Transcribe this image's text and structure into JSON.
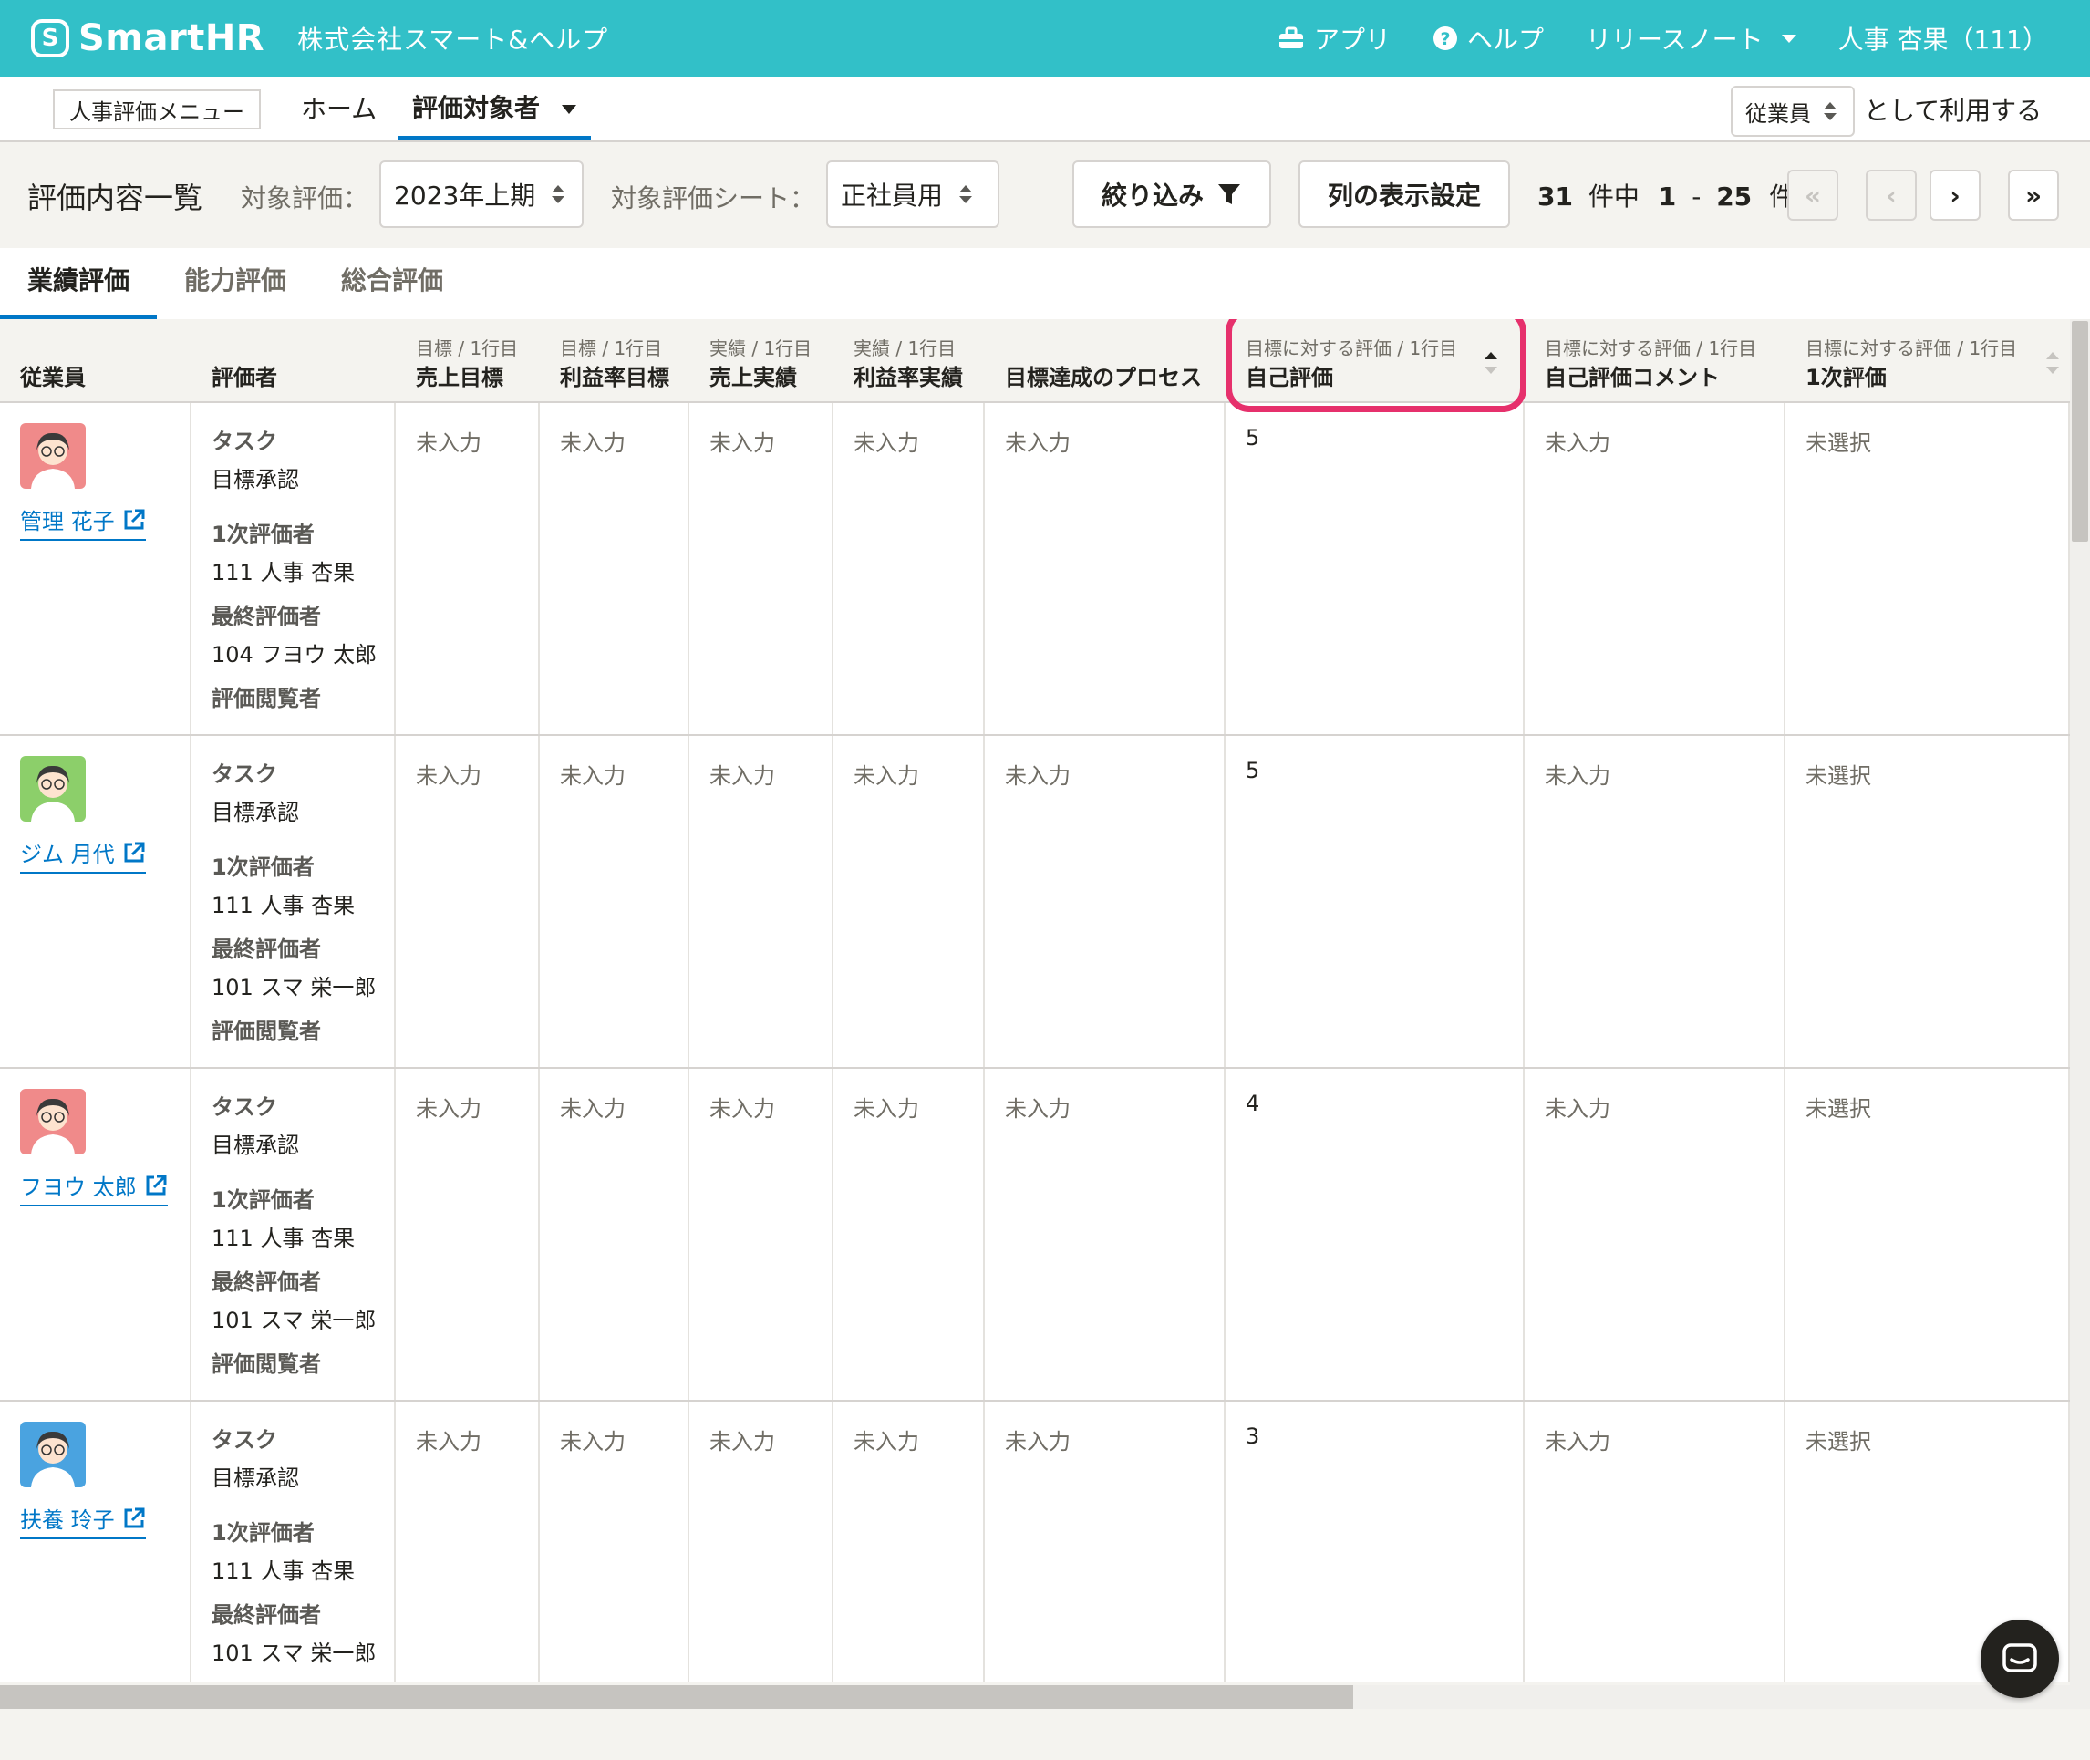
{
  "header": {
    "logo_text": "SmartHR",
    "company": "株式会社スマート&ヘルプ",
    "apps_label": "アプリ",
    "help_label": "ヘルプ",
    "release_notes_label": "リリースノート",
    "user_label": "人事 杏果（111）"
  },
  "subnav": {
    "menu_label": "人事評価メニュー",
    "home_label": "ホーム",
    "target_label": "評価対象者",
    "role_value": "従業員",
    "role_suffix": "として利用する"
  },
  "toolbar": {
    "title": "評価内容一覧",
    "eval_label": "対象評価：",
    "eval_value": "2023年上期",
    "sheet_label": "対象評価シート：",
    "sheet_value": "正社員用",
    "filter_label": "絞り込み",
    "columns_label": "列の表示設定",
    "total": "31",
    "count_mid": "件中",
    "range_start": "1",
    "range_sep": "-",
    "range_end": "25",
    "count_suffix": "件",
    "first_label": "«",
    "prev_label": "‹",
    "next_label": "›",
    "last_label": "»"
  },
  "tabs": [
    "業績評価",
    "能力評価",
    "総合評価"
  ],
  "columns": {
    "employee": "従業員",
    "evaluator": "評価者",
    "c1_sub": "目標 / 1行目",
    "c1_main": "売上目標",
    "c2_sub": "目標 / 1行目",
    "c2_main": "利益率目標",
    "c3_sub": "実績 / 1行目",
    "c3_main": "売上実績",
    "c4_sub": "実績 / 1行目",
    "c4_main": "利益率実績",
    "c5_main": "目標達成のプロセス",
    "c6_sub": "目標に対する評価 / 1行目",
    "c6_main": "自己評価",
    "c7_sub": "目標に対する評価 / 1行目",
    "c7_main": "自己評価コメント",
    "c8_sub": "目標に対する評価 / 1行目",
    "c8_main": "1次評価"
  },
  "labels": {
    "task": "タスク",
    "goal_approval": "目標承認",
    "first_evaluator": "1次評価者",
    "final_evaluator": "最終評価者",
    "viewer": "評価閲覧者",
    "not_entered": "未入力",
    "not_selected": "未選択"
  },
  "rows": [
    {
      "name": "管理 花子",
      "first": "111 人事 杏果",
      "final": "104 フヨウ 太郎",
      "self_eval": "5",
      "avatar_color": "#f08a8a"
    },
    {
      "name": "ジム 月代",
      "first": "111 人事 杏果",
      "final": "101 スマ 栄一郎",
      "self_eval": "5",
      "avatar_color": "#8ccf6a"
    },
    {
      "name": "フヨウ 太郎",
      "first": "111 人事 杏果",
      "final": "101 スマ 栄一郎",
      "self_eval": "4",
      "avatar_color": "#f08a8a"
    },
    {
      "name": "扶養 玲子",
      "first": "111 人事 杏果",
      "final": "101 スマ 栄一郎",
      "self_eval": "3",
      "avatar_color": "#4aa3e0"
    }
  ],
  "colors": {
    "brand": "#32c0c8",
    "link": "#0077c7",
    "highlight": "#e6306c"
  }
}
